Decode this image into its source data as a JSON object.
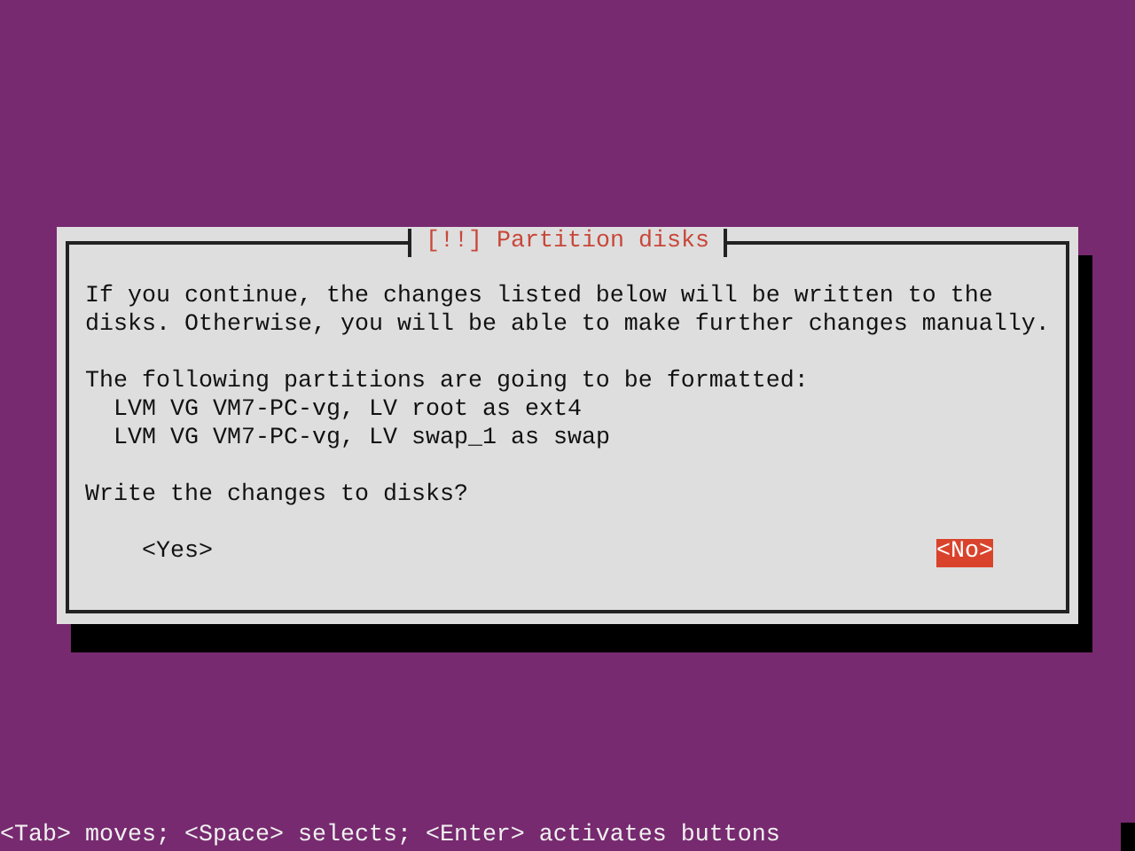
{
  "dialog": {
    "title": "[!!] Partition disks",
    "message": "If you continue, the changes listed below will be written to the disks. Otherwise, you will be able to make further changes manually.",
    "list_heading": "The following partitions are going to be formatted:",
    "partitions": [
      "LVM VG VM7-PC-vg, LV root as ext4",
      "LVM VG VM7-PC-vg, LV swap_1 as swap"
    ],
    "question": "Write the changes to disks?",
    "buttons": [
      {
        "label": "<Yes>",
        "selected": false
      },
      {
        "label": "<No>",
        "selected": true
      }
    ]
  },
  "help_bar": "<Tab> moves; <Space> selects; <Enter> activates buttons"
}
